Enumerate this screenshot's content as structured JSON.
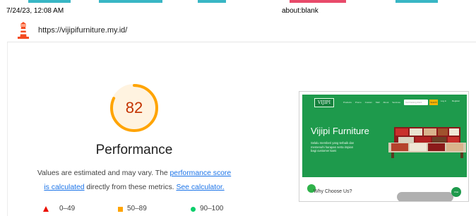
{
  "print_header": {
    "datetime": "7/24/23, 12:08 AM",
    "page_title": "about:blank"
  },
  "report": {
    "url": "https://vijipifurniture.my.id/",
    "score": "82",
    "category_title": "Performance",
    "description": {
      "part1": "Values are estimated and may vary. The ",
      "link1": "performance score is calculated",
      "part2": " directly from these metrics. ",
      "link2": "See calculator."
    },
    "legend": [
      {
        "range": "0–49",
        "color": "#eb0f00"
      },
      {
        "range": "50–89",
        "color": "#ffa400"
      },
      {
        "range": "90–100",
        "color": "#0cce6b"
      }
    ],
    "score_value": 0.82,
    "colors": {
      "average": "#ffa400",
      "average_text": "#c33300",
      "link": "#1a73e8"
    }
  },
  "thumbnail": {
    "logo_text": "VIJIPI",
    "nav": [
      "Products",
      "Promo",
      "Custom",
      "Mall",
      "About",
      "Services",
      "Others"
    ],
    "search_placeholder": "Cari barang disini",
    "search_button": "Search",
    "login": "Log in",
    "register": "Register",
    "hero_title": "Vijipi Furniture",
    "hero_tagline": "Selalu memberi yang terbaik dan memenuhi harapan serta impian bagi customer kami",
    "section_title": "Why Choose Us?",
    "chat_button": "Chat",
    "brand_color": "#1e9a4c"
  }
}
